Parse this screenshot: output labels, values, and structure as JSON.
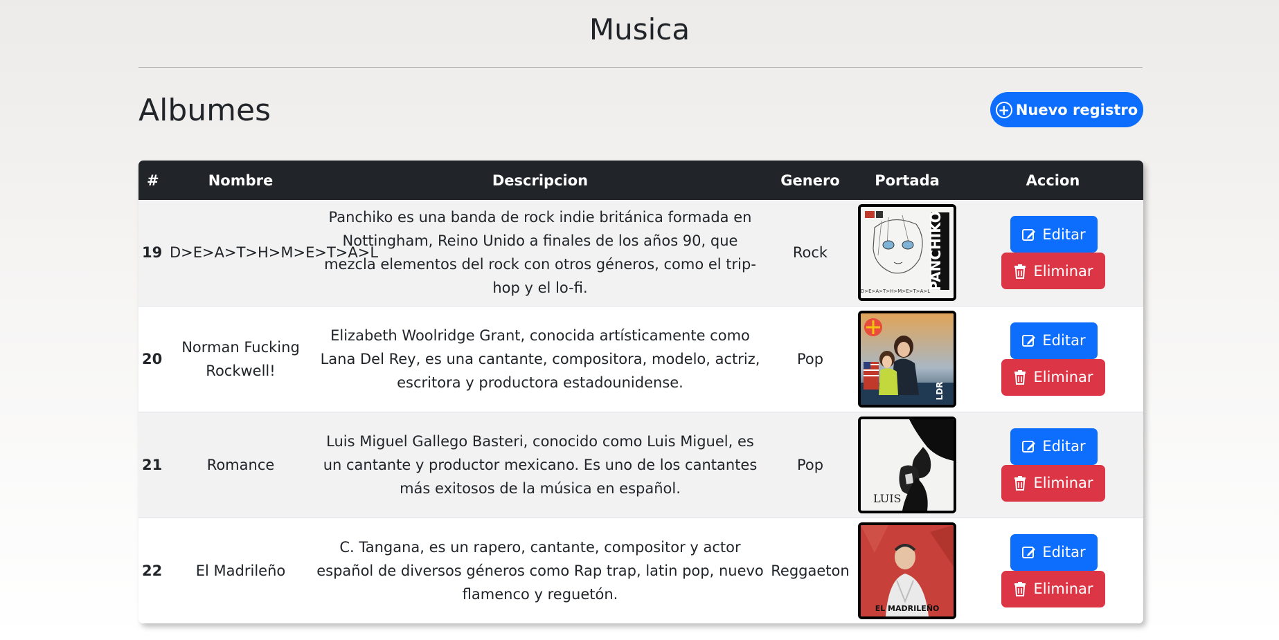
{
  "header": {
    "title": "Musica"
  },
  "section": {
    "title": "Albumes",
    "new_button_label": "Nuevo registro"
  },
  "table": {
    "columns": [
      "#",
      "Nombre",
      "Descripcion",
      "Genero",
      "Portada",
      "Accion"
    ],
    "edit_label": "Editar",
    "delete_label": "Eliminar",
    "rows": [
      {
        "id": "19",
        "name": "D>E>A>T>H>M>E>T>A>L",
        "description": "Panchiko es una banda de rock indie británica formada en Nottingham, Reino Unido a finales de los años 90, que mezcla elementos del rock con otros géneros, como el trip-hop y el lo-fi.",
        "genre": "Rock",
        "cover_text": "PANCHIKO",
        "cover_subtext": "D>E>A>T>H>M>E>T>A>L"
      },
      {
        "id": "20",
        "name": "Norman Fucking Rockwell!",
        "description": "Elizabeth Woolridge Grant, conocida artísticamente como Lana Del Rey, es una cantante, compositora, modelo, actriz, escritora y productora estadounidense.",
        "genre": "Pop",
        "cover_text": "LDR",
        "cover_subtext": ""
      },
      {
        "id": "21",
        "name": "Romance",
        "description": "Luis Miguel Gallego Basteri,  conocido como Luis Miguel, es un cantante y productor mexicano. Es uno de los cantantes más exitosos de la música en español.",
        "genre": "Pop",
        "cover_text": "LUIS",
        "cover_subtext": ""
      },
      {
        "id": "22",
        "name": "El Madrileño",
        "description": "C. Tangana, es un rapero, cantante, compositor y actor español de diversos géneros como Rap trap, latin pop, nuevo flamenco y reguetón.",
        "genre": "Reggaeton",
        "cover_text": "EL MADRILEÑO",
        "cover_subtext": ""
      }
    ]
  },
  "colors": {
    "primary": "#0d6efd",
    "danger": "#dc3545",
    "header_bg": "#212529"
  },
  "icons": {
    "new": "plus-circle-icon",
    "edit": "pencil-square-icon",
    "delete": "trash-icon"
  }
}
